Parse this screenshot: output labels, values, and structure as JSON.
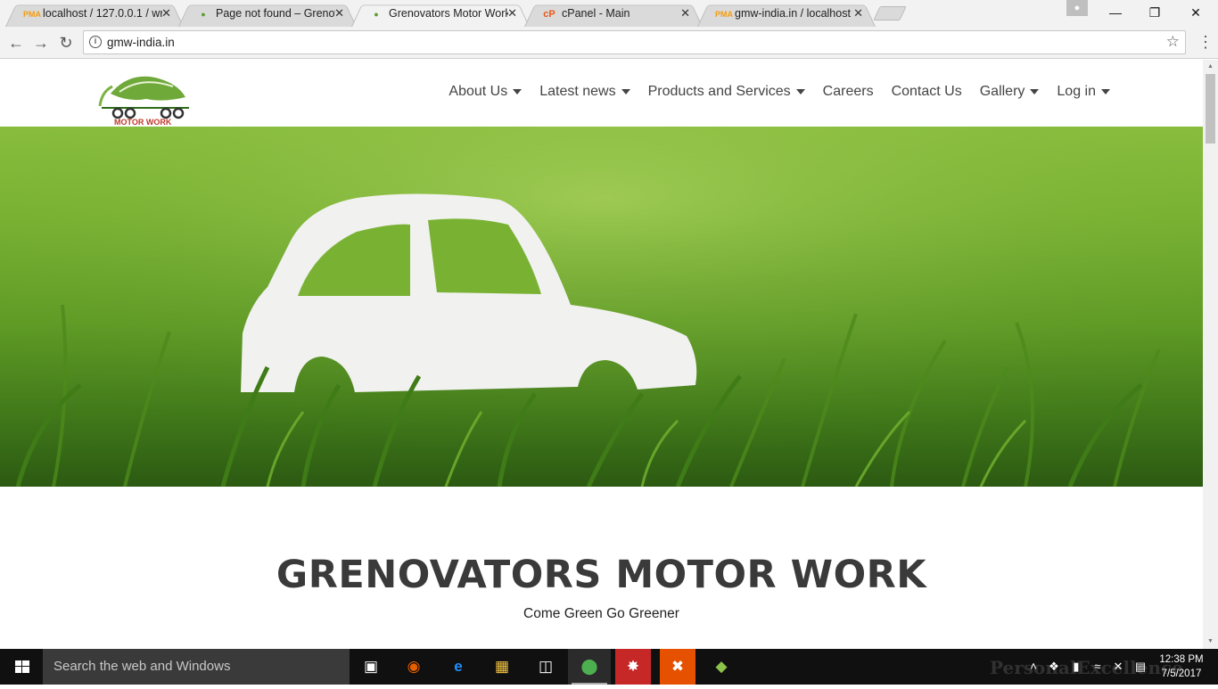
{
  "browser": {
    "tabs": [
      {
        "title": "localhost / 127.0.0.1 / wr",
        "favicon": "phpmyadmin-icon",
        "active": false
      },
      {
        "title": "Page not found – Grenov",
        "favicon": "car-logo-icon",
        "active": false
      },
      {
        "title": "Grenovators Motor Work",
        "favicon": "car-logo-icon",
        "active": true
      },
      {
        "title": "cPanel - Main",
        "favicon": "cpanel-icon",
        "active": false
      },
      {
        "title": "gmw-india.in / localhost",
        "favicon": "phpmyadmin-icon",
        "active": false
      }
    ],
    "url": "gmw-india.in",
    "window_controls": {
      "minimize": "—",
      "maximize": "❐",
      "close": "✕"
    }
  },
  "site": {
    "logo_text": "MOTOR WORK",
    "logo_arc_text": "GRENOVATORS",
    "nav": [
      {
        "label": "About Us",
        "dropdown": true
      },
      {
        "label": "Latest news",
        "dropdown": true
      },
      {
        "label": "Products and Services",
        "dropdown": true
      },
      {
        "label": "Careers",
        "dropdown": false
      },
      {
        "label": "Contact Us",
        "dropdown": false
      },
      {
        "label": "Gallery",
        "dropdown": true
      },
      {
        "label": "Log in",
        "dropdown": true
      }
    ],
    "headline": "GRENOVATORS MOTOR WORK",
    "tagline": "Come Green Go Greener"
  },
  "taskbar": {
    "search_placeholder": "Search the web and Windows",
    "time": "12:38 PM",
    "date": "7/5/2017",
    "watermark": "PersonalExcellence"
  },
  "colors": {
    "grass": "#6aa82c",
    "heading": "#3a3a3a",
    "taskbar": "#101010"
  }
}
